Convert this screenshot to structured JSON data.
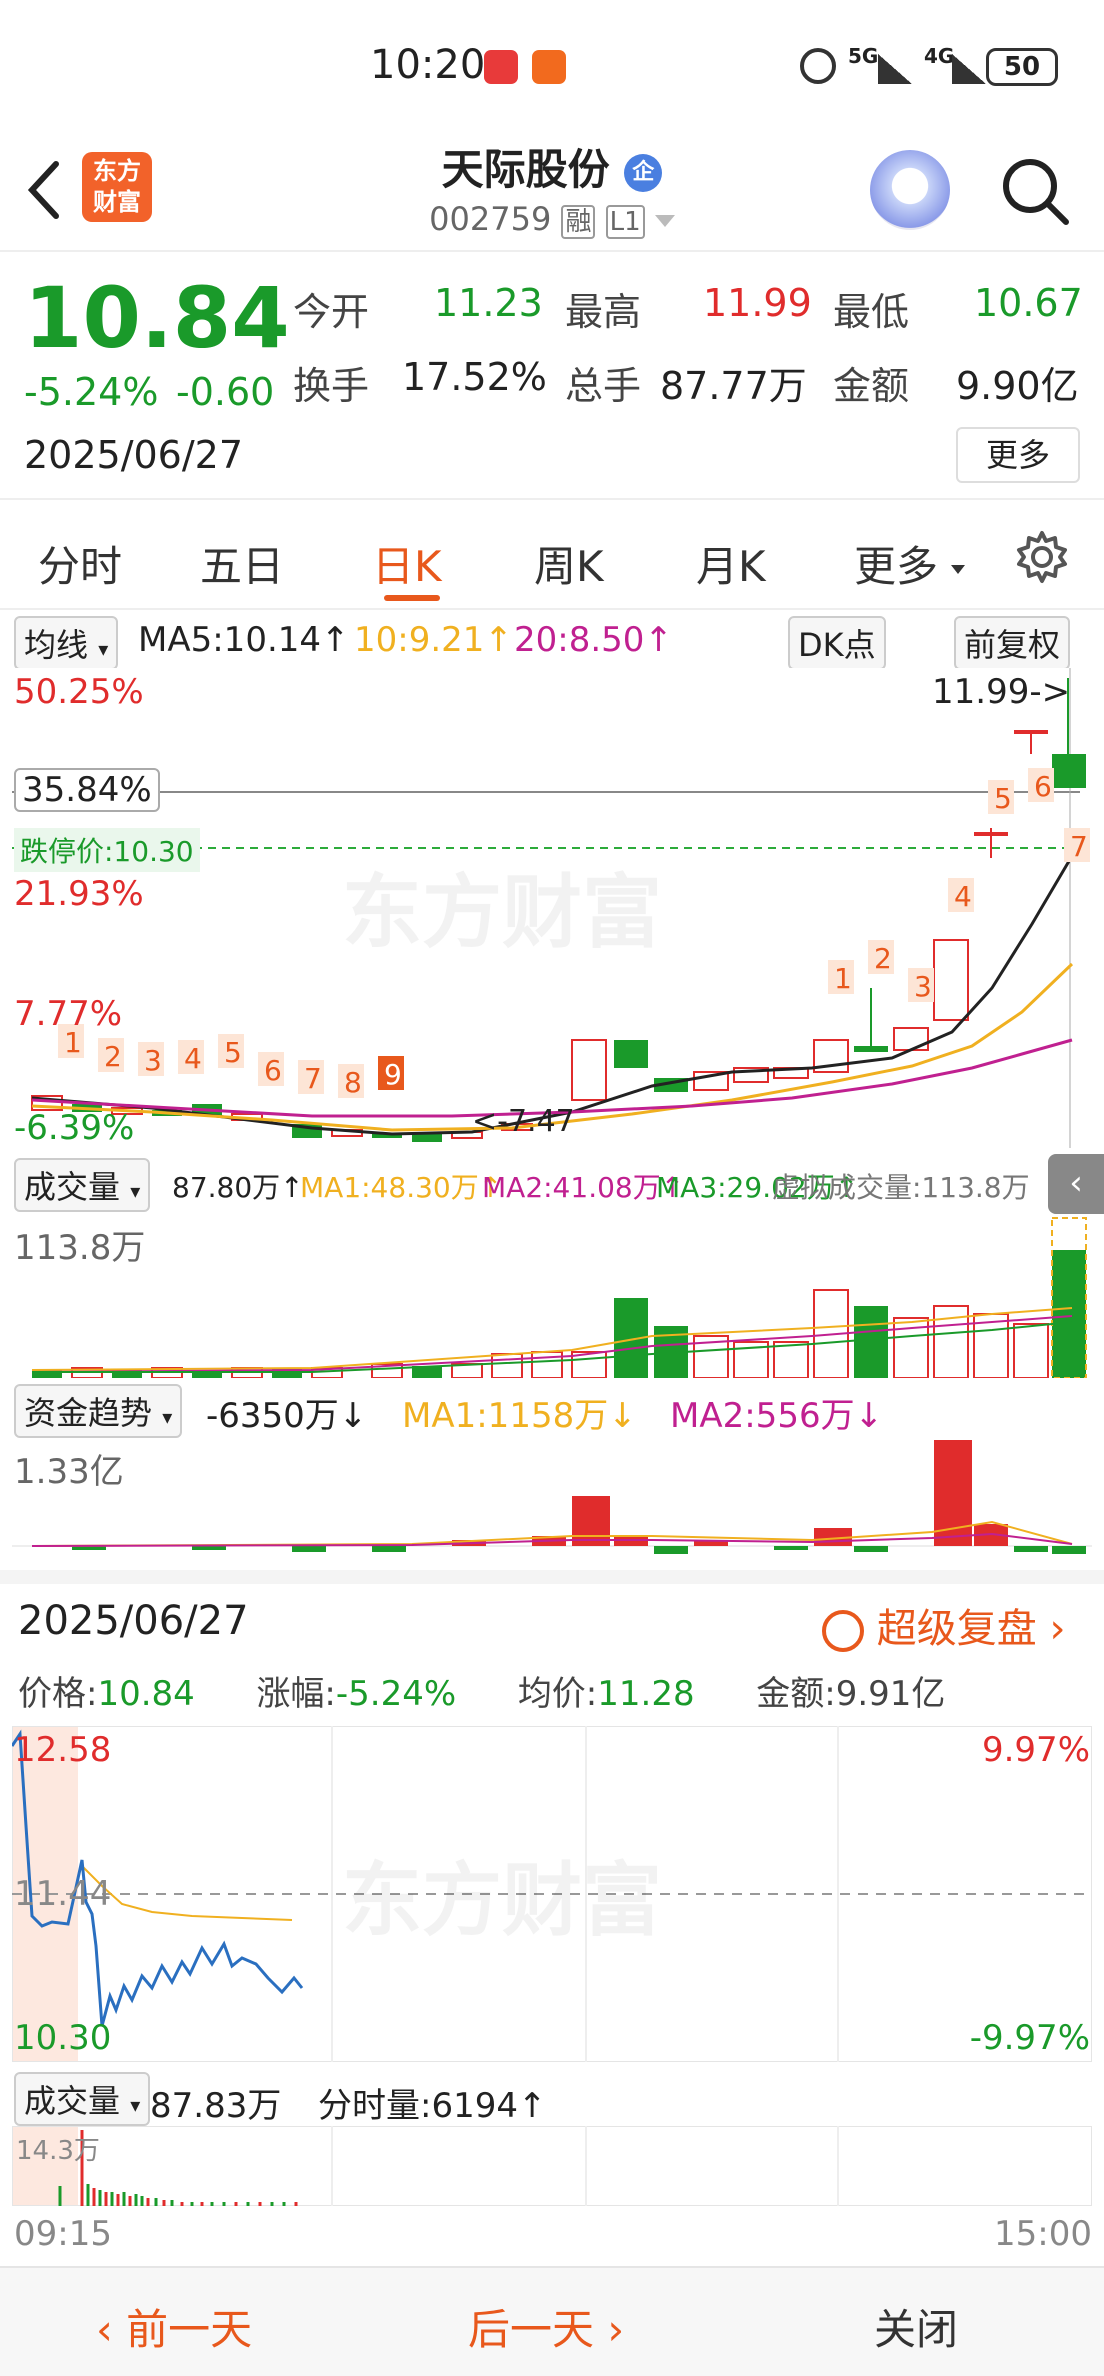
{
  "status_bar": {
    "time": "10:20",
    "signal1": "5G",
    "signal2": "4G",
    "battery": "50"
  },
  "header": {
    "logo_text_top": "东方",
    "logo_text_bottom": "财富",
    "stock_name": "天际股份",
    "name_badge": "企",
    "stock_code": "002759",
    "tag_margin": "融",
    "tag_level": "L1"
  },
  "quote": {
    "price": "10.84",
    "change_pct": "-5.24%",
    "change_amt": "-0.60",
    "date": "2025/06/27",
    "open_label": "今开",
    "open": "11.23",
    "high_label": "最高",
    "high": "11.99",
    "low_label": "最低",
    "low": "10.67",
    "turnover_label": "换手",
    "turnover": "17.52%",
    "volume_label": "总手",
    "volume": "87.77万",
    "amount_label": "金额",
    "amount": "9.90亿",
    "more_button": "更多"
  },
  "tabs": [
    "分时",
    "五日",
    "日K",
    "周K",
    "月K",
    "更多"
  ],
  "active_tab": "日K",
  "kline": {
    "indicator_select": "均线",
    "ma5": "MA5:10.14↑",
    "ma10": "10:9.21↑",
    "ma20": "20:8.50↑",
    "dk_select": "DK点",
    "adjust_select": "前复权",
    "label_top_pct": "50.25%",
    "label_hover_pct": "35.84%",
    "limit_down_label": "跌停价:10.30",
    "label_mid_pct": "21.93%",
    "label_low_pct": "7.77%",
    "label_bottom_pct": "-6.39%",
    "high_marker": "11.99->",
    "low_marker": "<-7.47",
    "watermark": "东方财富",
    "seq_labels": [
      "1",
      "2",
      "3",
      "4",
      "5",
      "6",
      "7",
      "8",
      "9"
    ],
    "right_seq_labels": [
      "1",
      "2",
      "3",
      "4",
      "5",
      "6",
      "7"
    ]
  },
  "volume_panel": {
    "select": "成交量",
    "value": "87.80万↑",
    "ma1": "MA1:48.30万↑",
    "ma2": "MA2:41.08万↑",
    "ma3": "MA3:29.02万↑",
    "virtual": "虚拟成交量:113.8万",
    "axis_max": "113.8万"
  },
  "fund_panel": {
    "select": "资金趋势",
    "value": "-6350万↓",
    "ma1": "MA1:1158万↓",
    "ma2": "MA2:556万↓",
    "axis_max": "1.33亿"
  },
  "replay": {
    "date": "2025/06/27",
    "super_replay": "超级复盘",
    "price_label": "价格:",
    "price": "10.84",
    "change_label": "涨幅:",
    "change": "-5.24%",
    "avg_label": "均价:",
    "avg": "11.28",
    "amount_label": "金额:",
    "amount": "9.91亿",
    "top_price": "12.58",
    "mid_price": "11.44",
    "bottom_price": "10.30",
    "top_pct": "9.97%",
    "bottom_pct": "-9.97%",
    "vol_select": "成交量",
    "vol_value": "87.83万",
    "tick_vol": "分时量:6194↑",
    "vol_axis_max": "14.3万",
    "time_start": "09:15",
    "time_end": "15:00"
  },
  "bottom_nav": {
    "prev": "前一天",
    "next": "后一天",
    "close": "关闭"
  },
  "colors": {
    "accent": "#e8581c",
    "up": "#e02c2c",
    "down": "#1a9a2a",
    "ma10": "#f0b020",
    "ma20": "#c02090"
  }
}
